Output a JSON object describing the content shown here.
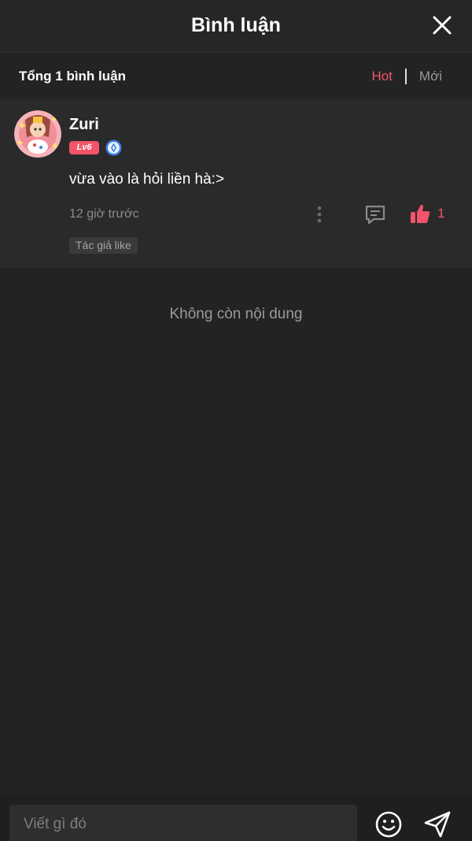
{
  "header": {
    "title": "Bình luận",
    "close_icon": "close-icon"
  },
  "summary": {
    "total_label": "Tổng 1 bình luận",
    "sort_hot": "Hot",
    "sort_new": "Mới",
    "active_sort": "Hot"
  },
  "comment": {
    "username": "Zuri",
    "level": "Lv6",
    "verify_icon": "verified-shield-icon",
    "text": "vừa vào là hỏi liền hà:>",
    "time": "12 giờ trước",
    "like_count": "1",
    "author_like_tag": "Tác giả like",
    "icons": [
      "more-vertical-icon",
      "reply-icon",
      "thumbs-up-icon"
    ]
  },
  "empty_state": {
    "message": "Không còn nội dung"
  },
  "composer": {
    "placeholder": "Viết gì đó",
    "value": "",
    "icons": [
      "emoji-icon",
      "send-icon"
    ]
  },
  "colors": {
    "background": "#232323",
    "accent": "#f2546a",
    "muted_text": "#9a9a9a"
  }
}
